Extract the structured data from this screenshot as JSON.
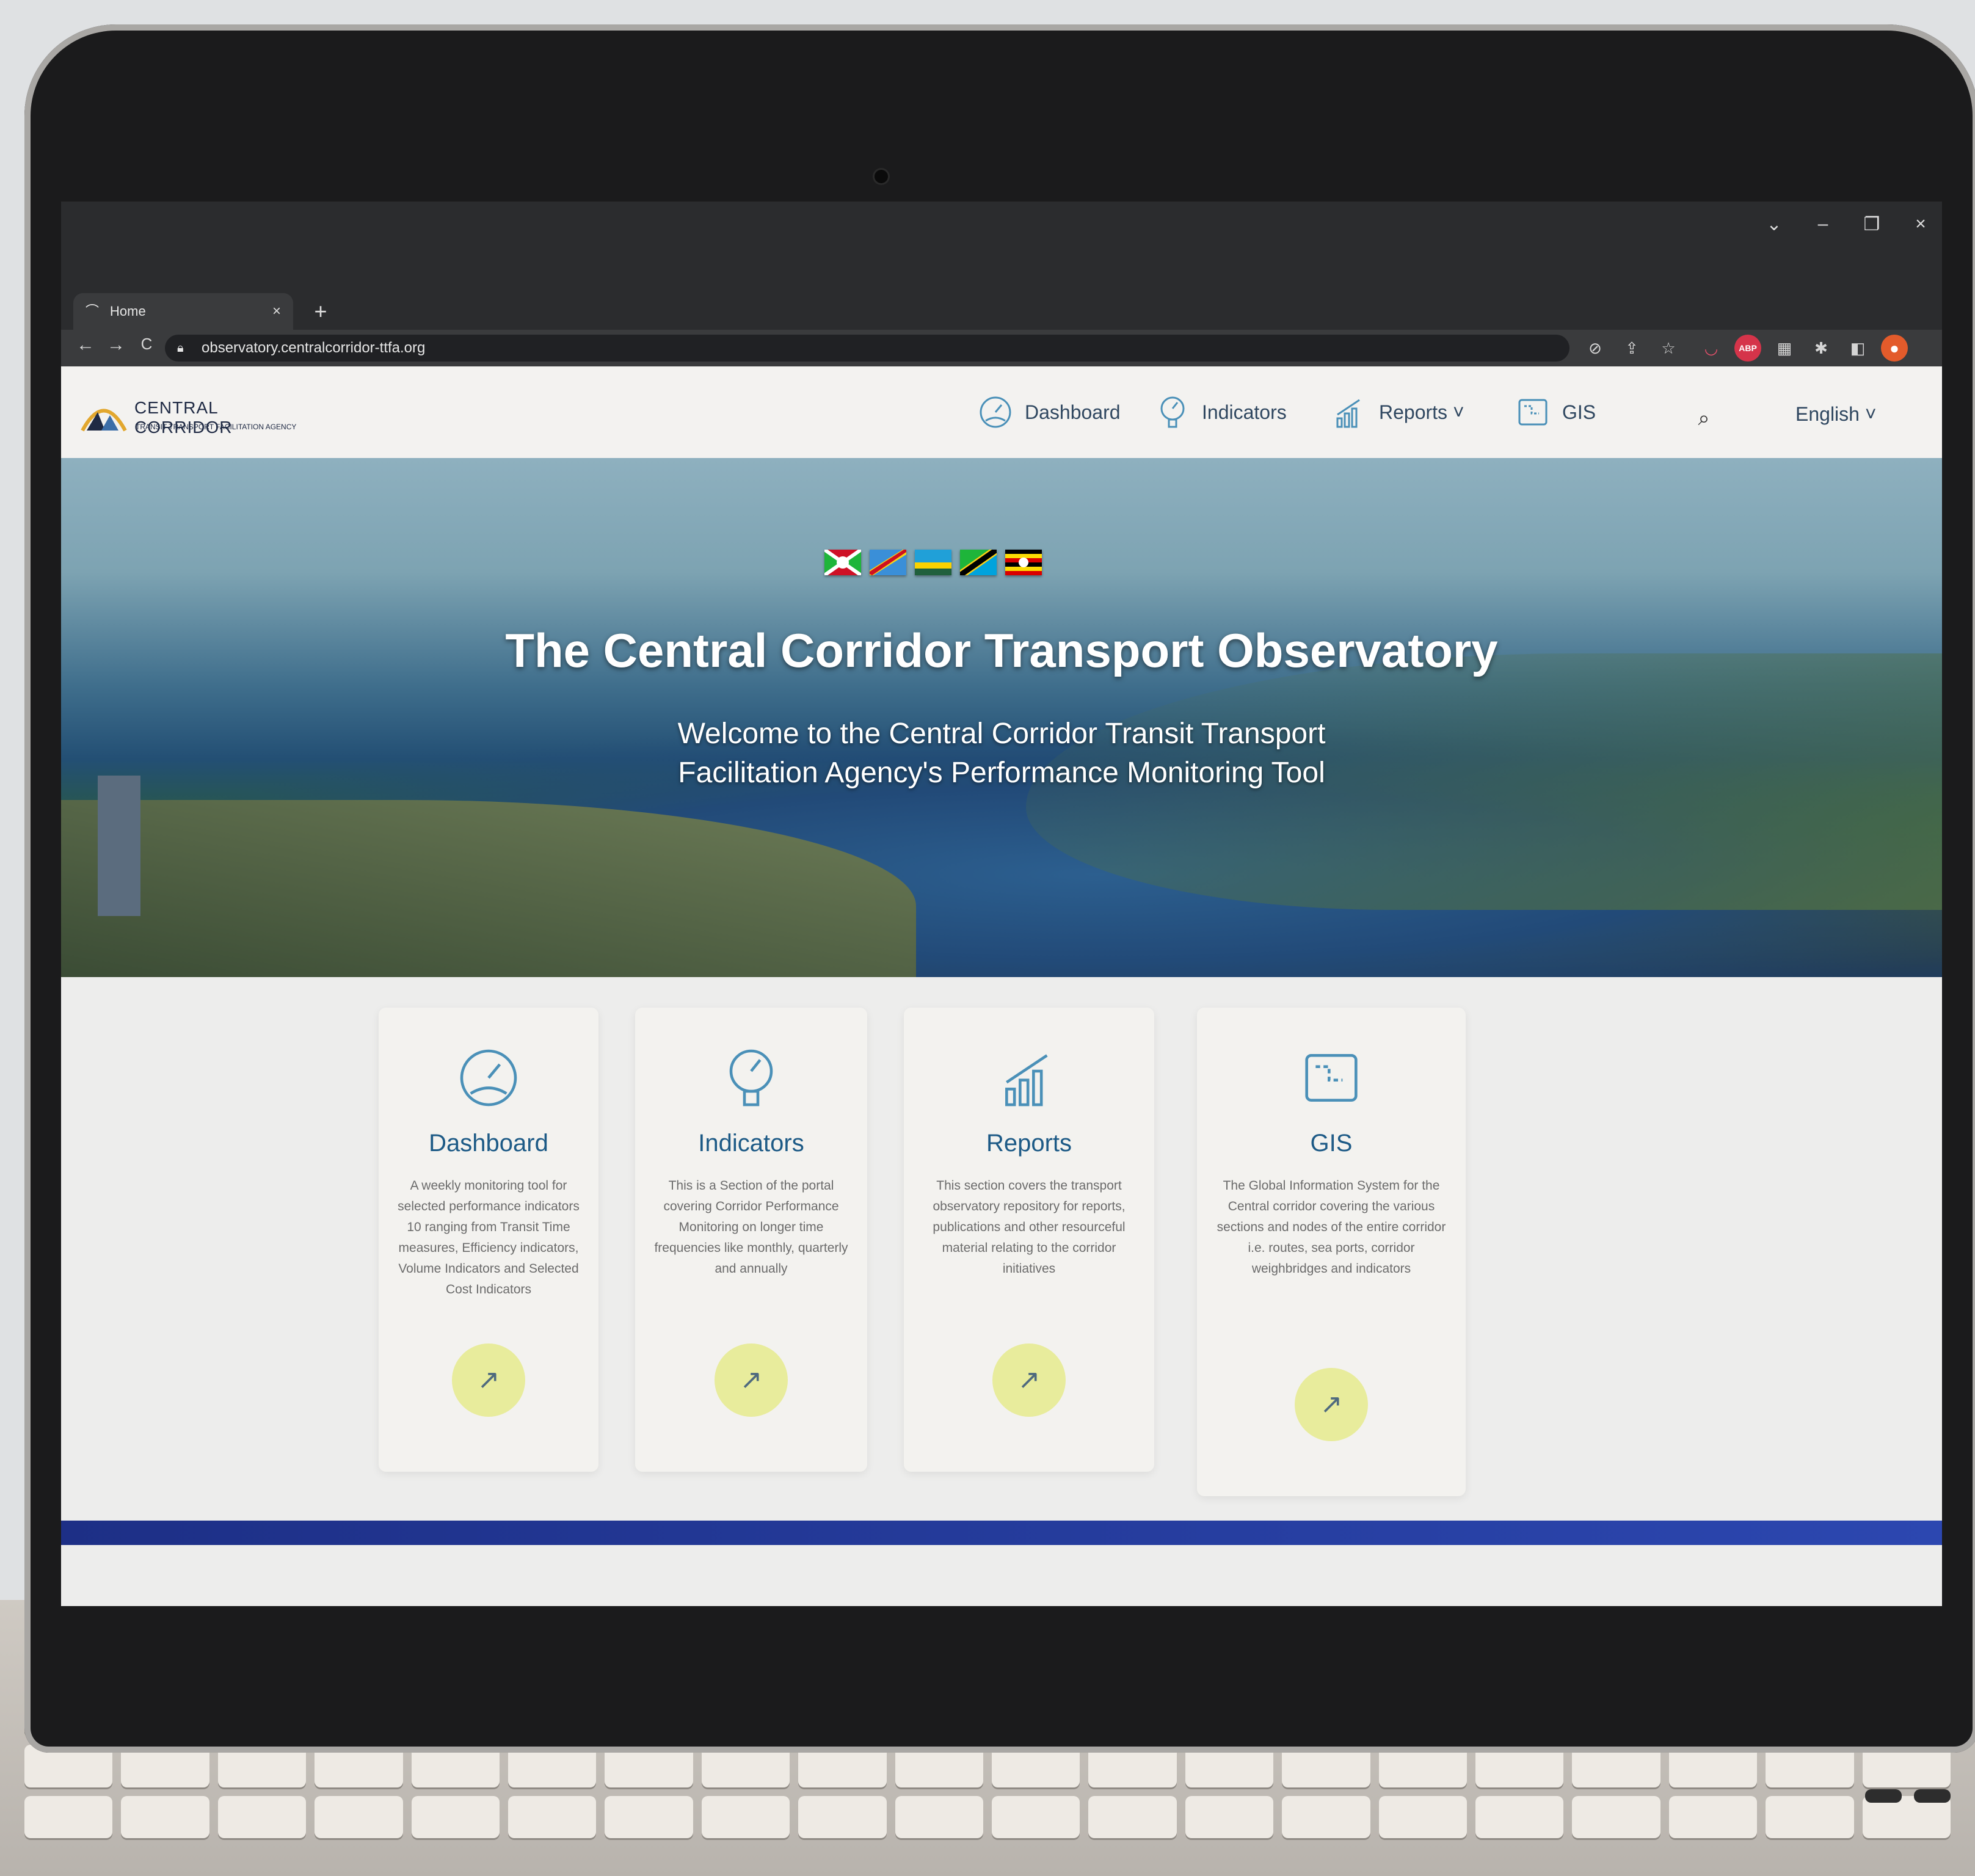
{
  "browser": {
    "tab_title": "Home",
    "tab_close": "×",
    "new_tab": "+",
    "url": "observatory.centralcorridor-ttfa.org",
    "nav_back": "←",
    "nav_forward": "→",
    "nav_reload": "C",
    "window_controls": [
      "⌄",
      "–",
      "❐",
      "×"
    ],
    "toolbar_icons": [
      "eye-off-icon",
      "share-icon",
      "star-icon",
      "pocket-icon",
      "adblock-icon",
      "extension-bar-icon",
      "puzzle-icon",
      "sidepanel-icon",
      "profile-icon"
    ],
    "adblock_label": "ABP"
  },
  "header": {
    "logo_title": "CENTRAL CORRIDOR",
    "logo_subtitle": "TRANSIT TRANSPORT FACILITATION AGENCY",
    "nav": [
      {
        "label": "Dashboard",
        "icon": "dashboard-gauge-icon"
      },
      {
        "label": "Indicators",
        "icon": "indicators-meter-icon"
      },
      {
        "label": "Reports ˅",
        "icon": "reports-chart-icon"
      },
      {
        "label": "GIS",
        "icon": "gis-map-icon"
      }
    ],
    "language": "English ˅"
  },
  "hero": {
    "flags": [
      "burundi",
      "drc",
      "rwanda",
      "tanzania",
      "uganda"
    ],
    "title": "The Central Corridor Transport Observatory",
    "subtitle_line1": "Welcome to the Central Corridor Transit Transport",
    "subtitle_line2": "Facilitation Agency's Performance Monitoring Tool"
  },
  "cards": [
    {
      "title": "Dashboard",
      "text": "A weekly monitoring tool for selected performance indicators 10 ranging from Transit Time measures, Efficiency indicators, Volume Indicators and Selected Cost Indicators",
      "go": "↗"
    },
    {
      "title": "Indicators",
      "text": "This is a Section of the portal covering Corridor Performance Monitoring on longer time frequencies like monthly, quarterly and annually",
      "go": "↗"
    },
    {
      "title": "Reports",
      "text": "This section covers the transport observatory repository for reports, publications and other resourceful material relating to the corridor initiatives",
      "go": "↗"
    },
    {
      "title": "GIS",
      "text": "The Global Information System for the Central corridor covering the various sections and nodes of the entire corridor i.e. routes, sea ports, corridor weighbridges and indicators",
      "go": "↗"
    }
  ],
  "colors": {
    "accent_blue": "#1d5a86",
    "go_button": "#e8ec9c",
    "footer_bar": "#1d2f86"
  }
}
